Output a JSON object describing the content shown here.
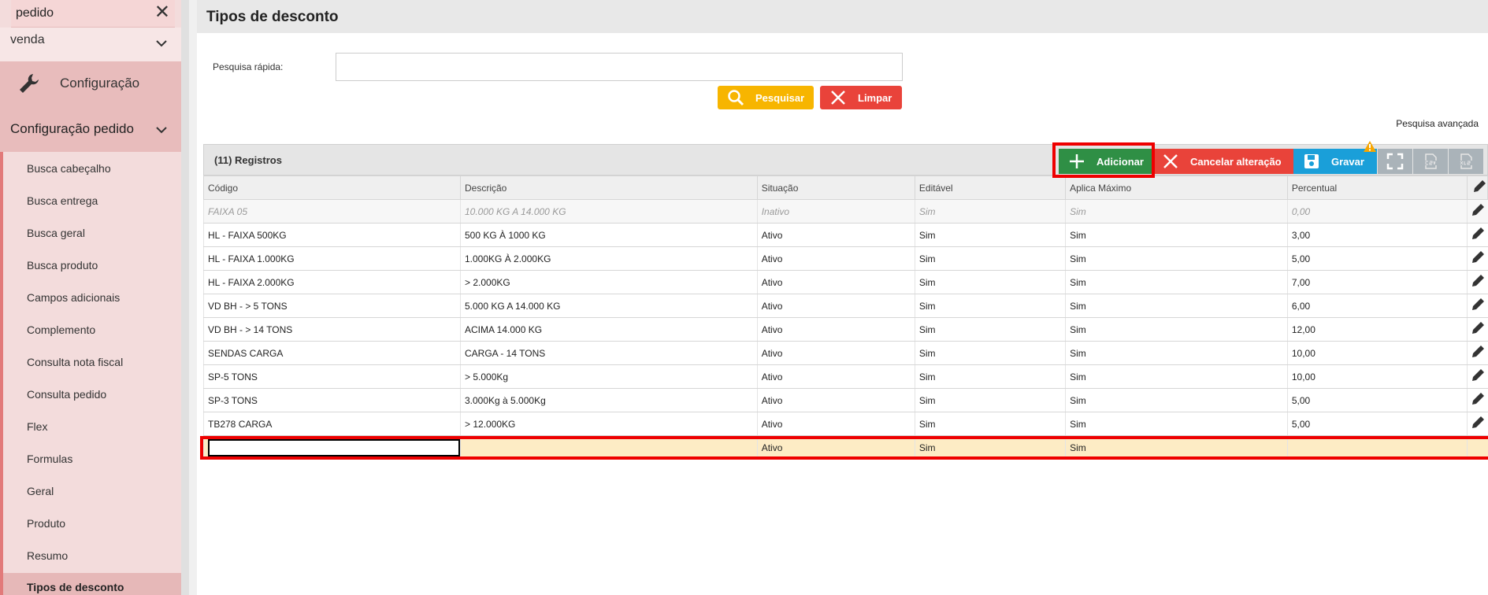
{
  "sidebar": {
    "search_text": "pedido",
    "venda_label": "venda",
    "config_label": "Configuração",
    "config_pedido_label": "Configuração pedido",
    "items": [
      {
        "label": "Busca cabeçalho"
      },
      {
        "label": "Busca entrega"
      },
      {
        "label": "Busca geral"
      },
      {
        "label": "Busca produto"
      },
      {
        "label": "Campos adicionais"
      },
      {
        "label": "Complemento"
      },
      {
        "label": "Consulta nota fiscal"
      },
      {
        "label": "Consulta pedido"
      },
      {
        "label": "Flex"
      },
      {
        "label": "Formulas"
      },
      {
        "label": "Geral"
      },
      {
        "label": "Produto"
      },
      {
        "label": "Resumo"
      },
      {
        "label": "Tipos de desconto"
      }
    ]
  },
  "page": {
    "title": "Tipos de desconto",
    "quick_search_label": "Pesquisa rápida:",
    "search_button": "Pesquisar",
    "clear_button": "Limpar",
    "advanced_search": "Pesquisa avançada"
  },
  "grid": {
    "records_label": "(11) Registros",
    "toolbar": {
      "add": "Adicionar",
      "cancel": "Cancelar alteração",
      "save": "Gravar"
    },
    "columns": [
      "Código",
      "Descrição",
      "Situação",
      "Editável",
      "Aplica Máximo",
      "Percentual"
    ],
    "rows": [
      [
        "FAIXA 05",
        "10.000 KG A 14.000 KG",
        "Inativo",
        "Sim",
        "Sim",
        "0,00"
      ],
      [
        "HL - FAIXA 500KG",
        "500 KG À 1000 KG",
        "Ativo",
        "Sim",
        "Sim",
        "3,00"
      ],
      [
        "HL - FAIXA 1.000KG",
        "1.000KG À 2.000KG",
        "Ativo",
        "Sim",
        "Sim",
        "5,00"
      ],
      [
        "HL - FAIXA 2.000KG",
        "> 2.000KG",
        "Ativo",
        "Sim",
        "Sim",
        "7,00"
      ],
      [
        "VD BH - > 5 TONS",
        "5.000 KG A 14.000 KG",
        "Ativo",
        "Sim",
        "Sim",
        "6,00"
      ],
      [
        "VD BH - > 14 TONS",
        "ACIMA 14.000 KG",
        "Ativo",
        "Sim",
        "Sim",
        "12,00"
      ],
      [
        "SENDAS CARGA",
        "CARGA - 14 TONS",
        "Ativo",
        "Sim",
        "Sim",
        "10,00"
      ],
      [
        "SP-5 TONS",
        "> 5.000Kg",
        "Ativo",
        "Sim",
        "Sim",
        "10,00"
      ],
      [
        "SP-3 TONS",
        "3.000Kg à 5.000Kg",
        "Ativo",
        "Sim",
        "Sim",
        "5,00"
      ],
      [
        "TB278 CARGA",
        "> 12.000KG",
        "Ativo",
        "Sim",
        "Sim",
        "5,00"
      ]
    ],
    "new_row": {
      "situacao": "Ativo",
      "editavel": "Sim",
      "aplica_maximo": "Sim"
    }
  },
  "colors": {
    "accent_red": "#e9433a",
    "add_green": "#2f8f45",
    "save_blue": "#1a9fd9",
    "search_yellow": "#f7b500",
    "highlight": "#ee0000"
  }
}
